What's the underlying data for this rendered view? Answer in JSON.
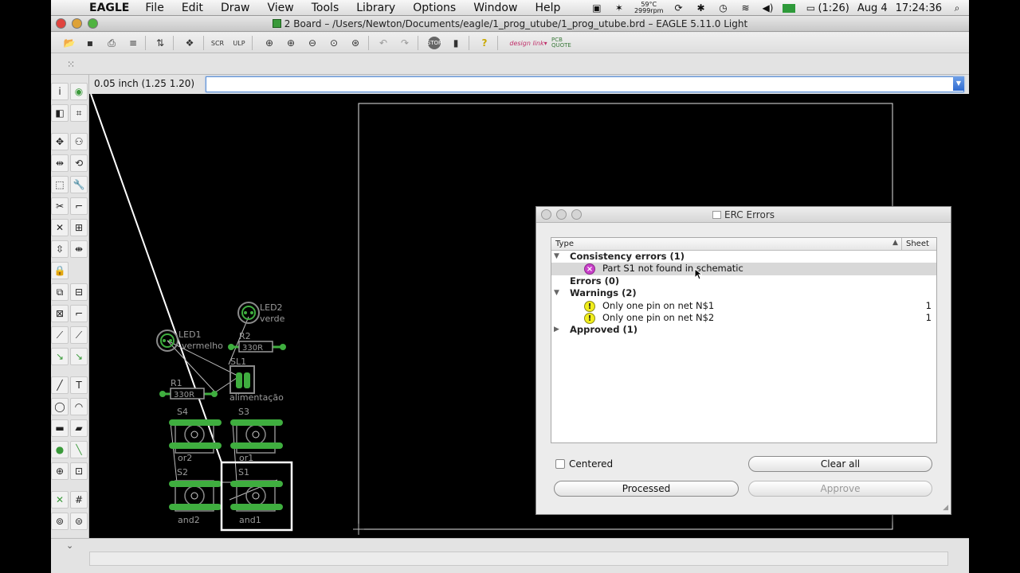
{
  "menubar": {
    "app_name": "EAGLE",
    "menus": [
      "File",
      "Edit",
      "Draw",
      "View",
      "Tools",
      "Library",
      "Options",
      "Window",
      "Help"
    ],
    "temperature": "59°C",
    "fan": "2999rpm",
    "battery": "(1:26)",
    "date": "Aug 4",
    "time": "17:24:36"
  },
  "window": {
    "title": "2 Board – /Users/Newton/Documents/eagle/1_prog_utube/1_prog_utube.brd – EAGLE 5.11.0 Light"
  },
  "toolbar": {
    "designlink_label": "design link",
    "pcb_quote_label": "PCB QUOTE"
  },
  "command": {
    "coordinates": "0.05 inch (1.25 1.20)",
    "value": ""
  },
  "board": {
    "labels": {
      "led1": "LED1",
      "led1_value": "vermelho",
      "led2": "LED2",
      "led2_value": "verde",
      "r1": "R1",
      "r1_value": "330R",
      "r2": "R2",
      "r2_value": "330R",
      "sl1": "SL1",
      "sl1_value": "alimentação",
      "s1": "S1",
      "s1_value": "and1",
      "s2": "S2",
      "s2_value": "and2",
      "s3": "S3",
      "s3_value": "or1",
      "s4": "S4",
      "s4_value": "or2"
    },
    "colors": {
      "background": "#000000",
      "pad": "#3fae3f",
      "outline": "#ffffff",
      "ratsnest": "#cfcfcf"
    }
  },
  "erc_dialog": {
    "title": "ERC Errors",
    "columns": {
      "type": "Type",
      "sheet": "Sheet"
    },
    "groups": [
      {
        "label": "Consistency errors (1)",
        "expanded": true,
        "items": [
          {
            "kind": "error",
            "text": "Part S1 not found in schematic",
            "sheet": "",
            "selected": true
          }
        ]
      },
      {
        "label": "Errors (0)",
        "expanded": false,
        "items": []
      },
      {
        "label": "Warnings (2)",
        "expanded": true,
        "items": [
          {
            "kind": "warning",
            "text": "Only one pin on net N$1",
            "sheet": "1",
            "selected": false
          },
          {
            "kind": "warning",
            "text": "Only one pin on net N$2",
            "sheet": "1",
            "selected": false
          }
        ]
      },
      {
        "label": "Approved (1)",
        "expanded": false,
        "items": []
      }
    ],
    "centered_label": "Centered",
    "centered_checked": false,
    "buttons": {
      "clear_all": "Clear all",
      "processed": "Processed",
      "approve": "Approve"
    }
  }
}
